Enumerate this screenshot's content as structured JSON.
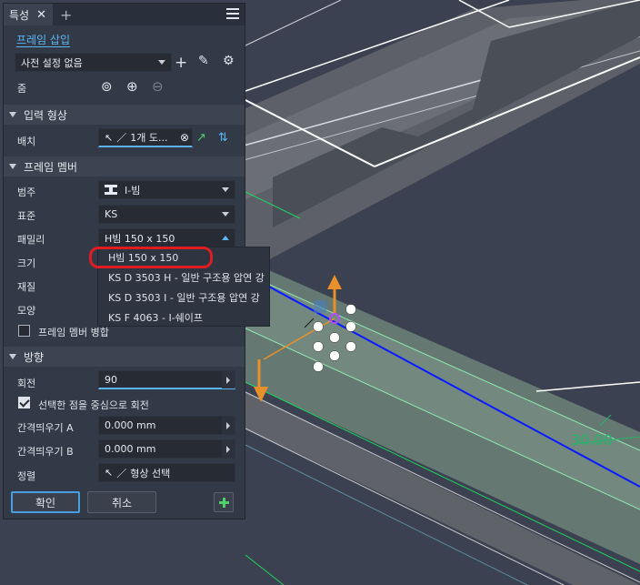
{
  "panel": {
    "tab_label": "특성",
    "frame_insert_link": "프레임 삽입",
    "preset": {
      "value": "사전 설정 없음"
    },
    "zoom_label": "줌",
    "input_shape": {
      "section_label": "입력 형상",
      "placement_label": "배치",
      "placement_value": "1개 도..."
    },
    "frame_member": {
      "section_label": "프레임 멤버",
      "category_label": "범주",
      "category_value": "I-빔",
      "standard_label": "표준",
      "standard_value": "KS",
      "family_label": "패밀리",
      "family_value": "H빔 150 x 150",
      "size_label": "크기",
      "material_label": "재질",
      "appearance_label": "모양",
      "merge_label": "프레임 멤버 병합",
      "merge_checked": false
    },
    "family_dropdown": {
      "options": [
        "H빔 150 x 150",
        "KS D 3503 H - 일반 구조용 압연 강",
        "KS D 3503 I - 일반 구조용 압연 강",
        "KS F 4063 - I-쉐이프"
      ]
    },
    "orientation": {
      "section_label": "방향",
      "rotation_label": "회전",
      "rotation_value": "90",
      "rotate_about_point_label": "선택한 점을 중심으로 회전",
      "rotate_about_point_checked": true,
      "offset_a_label": "간격띄우기 A",
      "offset_a_value": "0.000 mm",
      "offset_b_label": "간격띄우기 B",
      "offset_b_value": "0.000 mm",
      "align_label": "정렬",
      "align_value": "형상 선택"
    },
    "ok_label": "확인",
    "cancel_label": "취소"
  },
  "viewport": {
    "dimension_label": "30.00",
    "colors": {
      "beam_line": "#0a1aff",
      "dimension": "#23b36a",
      "axis_x": "#e8902a"
    }
  }
}
